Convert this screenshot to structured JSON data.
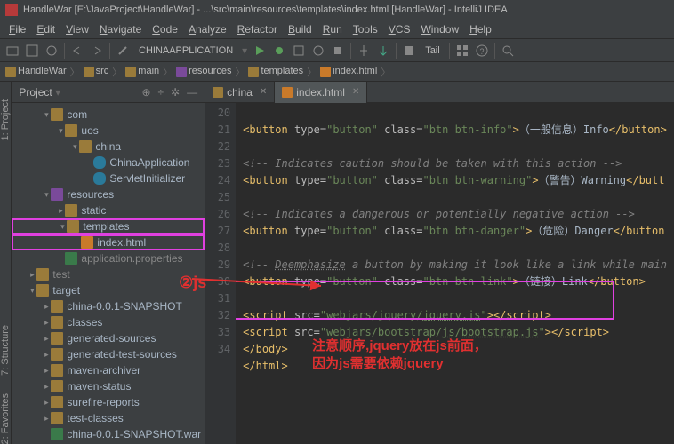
{
  "title": "HandleWar [E:\\JavaProject\\HandleWar] - ...\\src\\main\\resources\\templates\\index.html [HandleWar] - IntelliJ IDEA",
  "menu": [
    "File",
    "Edit",
    "View",
    "Navigate",
    "Code",
    "Analyze",
    "Refactor",
    "Build",
    "Run",
    "Tools",
    "VCS",
    "Window",
    "Help"
  ],
  "runconfig": "CHINAAPPLICATION",
  "tail": "Tail",
  "breadcrumbs": [
    "HandleWar",
    "src",
    "main",
    "resources",
    "templates",
    "index.html"
  ],
  "panel_title": "Project",
  "gutter_labels": [
    "1: Project",
    "7: Structure",
    "2: Favorites"
  ],
  "tree": [
    {
      "ind": 2,
      "arrow": "▾",
      "icon": "folder-ic",
      "label": "com"
    },
    {
      "ind": 3,
      "arrow": "▾",
      "icon": "folder-ic",
      "label": "uos"
    },
    {
      "ind": 4,
      "arrow": "▾",
      "icon": "folder-ic",
      "label": "china"
    },
    {
      "ind": 5,
      "arrow": "",
      "icon": "class-ic",
      "label": "ChinaApplication"
    },
    {
      "ind": 5,
      "arrow": "",
      "icon": "class-ic",
      "label": "ServletInitializer"
    },
    {
      "ind": 2,
      "arrow": "▾",
      "icon": "lib-ic",
      "label": "resources"
    },
    {
      "ind": 3,
      "arrow": "▸",
      "icon": "folder-ic",
      "label": "static"
    },
    {
      "ind": 3,
      "arrow": "▾",
      "icon": "folder-ic",
      "label": "templates",
      "sel": true
    },
    {
      "ind": 4,
      "arrow": "",
      "icon": "html-ic",
      "label": "index.html",
      "sel": true
    },
    {
      "ind": 3,
      "arrow": "",
      "icon": "file-ic",
      "label": "application.properties",
      "gray": true
    },
    {
      "ind": 1,
      "arrow": "▸",
      "icon": "folder-ic",
      "label": "test",
      "gray": true
    },
    {
      "ind": 1,
      "arrow": "▾",
      "icon": "folder-ic",
      "label": "target"
    },
    {
      "ind": 2,
      "arrow": "▸",
      "icon": "folder-ic",
      "label": "china-0.0.1-SNAPSHOT"
    },
    {
      "ind": 2,
      "arrow": "▸",
      "icon": "folder-ic",
      "label": "classes"
    },
    {
      "ind": 2,
      "arrow": "▸",
      "icon": "folder-ic",
      "label": "generated-sources"
    },
    {
      "ind": 2,
      "arrow": "▸",
      "icon": "folder-ic",
      "label": "generated-test-sources"
    },
    {
      "ind": 2,
      "arrow": "▸",
      "icon": "folder-ic",
      "label": "maven-archiver"
    },
    {
      "ind": 2,
      "arrow": "▸",
      "icon": "folder-ic",
      "label": "maven-status"
    },
    {
      "ind": 2,
      "arrow": "▸",
      "icon": "folder-ic",
      "label": "surefire-reports"
    },
    {
      "ind": 2,
      "arrow": "▸",
      "icon": "folder-ic",
      "label": "test-classes"
    },
    {
      "ind": 2,
      "arrow": "",
      "icon": "file-ic",
      "label": "china-0.0.1-SNAPSHOT.war"
    }
  ],
  "tabs": [
    {
      "label": "china",
      "icon": "folder-ic",
      "active": false
    },
    {
      "label": "index.html",
      "icon": "html-ic",
      "active": true
    }
  ],
  "line_start": 20,
  "line_end": 34,
  "ann_js": "②js",
  "ann_text1": "注意顺序,jquery放在js前面，",
  "ann_text2": "因为js需要依赖jquery"
}
